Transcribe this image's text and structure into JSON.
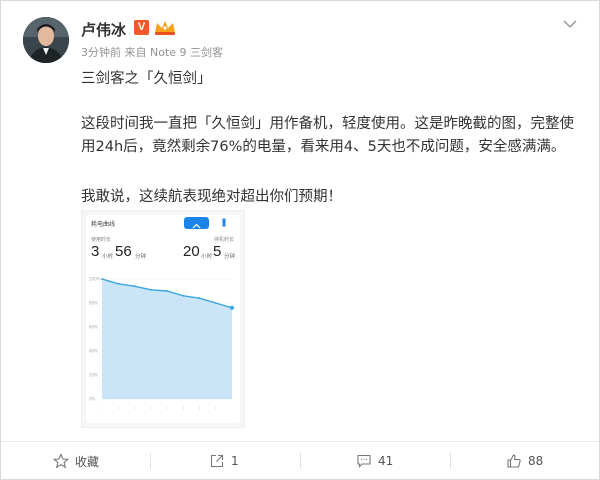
{
  "post": {
    "author": "卢伟冰",
    "verified_badge": "V",
    "meta": "3分钟前 来自 Note 9 三剑客",
    "title": "三剑客之「久恒剑」",
    "paragraph1": "这段时间我一直把「久恒剑」用作备机，轻度使用。这是昨晚截的图，完整使用24h后，竟然剩余76%的电量，看来用4、5天也不成问题，安全感满满。",
    "paragraph2": "我敢说，这续航表现绝对超出你们预期！"
  },
  "screenshot": {
    "panel_title": "耗电曲线",
    "usage_label": "使用时长",
    "standby_label": "待机时长",
    "usage_hours": "3",
    "usage_minutes": "56",
    "standby_hours": "20",
    "standby_minutes": "5",
    "unit_hour": "小时",
    "unit_minute": "分钟",
    "y_ticks": [
      "100%",
      "80%",
      "60%",
      "40%",
      "20%",
      "0%"
    ],
    "chart_data": {
      "type": "area",
      "x": [
        0,
        1,
        2,
        3,
        4,
        5,
        6,
        7,
        8
      ],
      "y": [
        100,
        96,
        94,
        91,
        90,
        86,
        84,
        80,
        76
      ],
      "ylim": [
        0,
        100
      ],
      "title": "",
      "xlabel": "",
      "ylabel": ""
    }
  },
  "toolbar": {
    "favorite_label": "收藏",
    "repost_count": "1",
    "comment_count": "41",
    "like_count": "88"
  },
  "colors": {
    "badge": "#f05a28",
    "accent_blue": "#1a84e8",
    "chart_line": "#3ba5e3",
    "chart_fill": "#bfe1f6"
  }
}
